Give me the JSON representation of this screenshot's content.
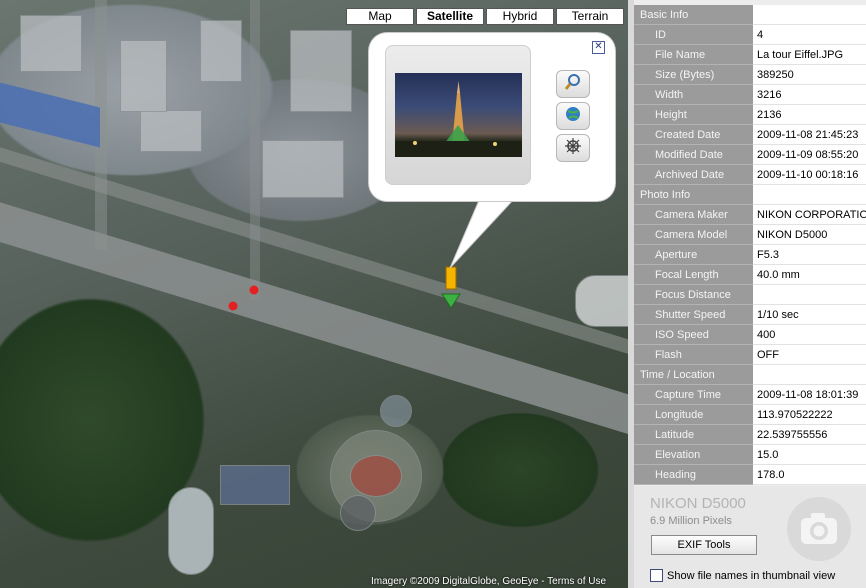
{
  "map": {
    "types": [
      "Map",
      "Satellite",
      "Hybrid",
      "Terrain"
    ],
    "active_type": "Satellite",
    "attribution": "Imagery ©2009 DigitalGlobe, GeoEye - Terms of Use",
    "bubble": {
      "close_label": "✕",
      "tool_icons": [
        "magnifier-icon",
        "globe-icon",
        "ship-wheel-icon"
      ]
    }
  },
  "properties": {
    "rows": [
      {
        "name": "Basic Info",
        "value": "",
        "category": true
      },
      {
        "name": "ID",
        "value": "4"
      },
      {
        "name": "File Name",
        "value": "La tour Eiffel.JPG"
      },
      {
        "name": "Size (Bytes)",
        "value": "389250"
      },
      {
        "name": "Width",
        "value": "3216"
      },
      {
        "name": "Height",
        "value": "2136"
      },
      {
        "name": "Created Date",
        "value": "2009-11-08 21:45:23"
      },
      {
        "name": "Modified Date",
        "value": "2009-11-09 08:55:20"
      },
      {
        "name": "Archived Date",
        "value": "2009-11-10 00:18:16"
      },
      {
        "name": "Photo Info",
        "value": "",
        "category": true
      },
      {
        "name": "Camera Maker",
        "value": "NIKON CORPORATION"
      },
      {
        "name": "Camera Model",
        "value": "NIKON D5000"
      },
      {
        "name": "Aperture",
        "value": "F5.3"
      },
      {
        "name": "Focal Length",
        "value": "40.0 mm"
      },
      {
        "name": "Focus Distance",
        "value": ""
      },
      {
        "name": "Shutter Speed",
        "value": "1/10 sec"
      },
      {
        "name": "ISO Speed",
        "value": "400"
      },
      {
        "name": "Flash",
        "value": "OFF"
      },
      {
        "name": "Time / Location",
        "value": "",
        "category": true
      },
      {
        "name": "Capture Time",
        "value": "2009-11-08 18:01:39"
      },
      {
        "name": "Longitude",
        "value": "113.970522222"
      },
      {
        "name": "Latitude",
        "value": "22.539755556"
      },
      {
        "name": "Elevation",
        "value": "15.0"
      },
      {
        "name": "Heading",
        "value": "178.0"
      }
    ]
  },
  "camera": {
    "model": "NIKON D5000",
    "pixels": "6.9 Million Pixels",
    "exif_button": "EXIF Tools",
    "show_names_label": "Show file names in thumbnail view",
    "show_names_checked": false
  },
  "colors": {
    "category_bg": "#9b9b9b",
    "map_marker": "#f4b400",
    "map_arrow": "#3cb043",
    "map_dot": "#e52020"
  }
}
